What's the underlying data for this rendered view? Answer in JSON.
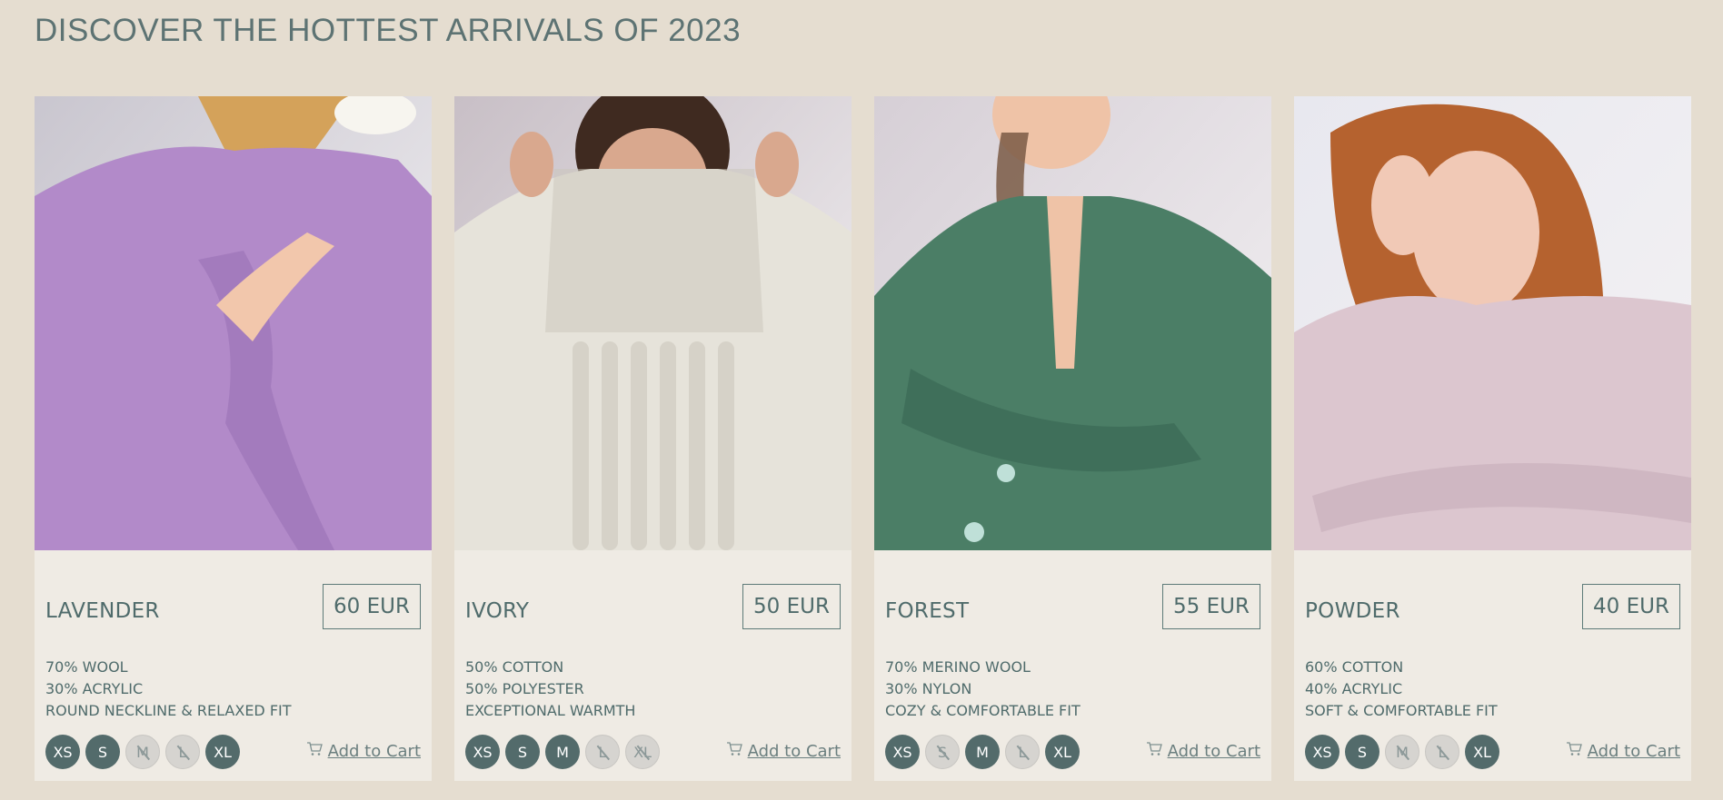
{
  "page": {
    "title": "DISCOVER THE HOTTEST ARRIVALS OF 2023"
  },
  "colors": {
    "background": "#e5ddd0",
    "card": "#efebe4",
    "accent": "#536b6b",
    "disabled": "#d6d4d0"
  },
  "products": [
    {
      "name": "LAVENDER",
      "price": "60 EUR",
      "features": [
        "70% WOOL",
        "30% ACRYLIC",
        "ROUND NECKLINE & RELAXED FIT"
      ],
      "sizes": [
        {
          "label": "XS",
          "available": true
        },
        {
          "label": "S",
          "available": true
        },
        {
          "label": "M",
          "available": false
        },
        {
          "label": "L",
          "available": false
        },
        {
          "label": "XL",
          "available": true
        }
      ],
      "cart_label": "Add to Cart",
      "image_colors": {
        "bg": "#c9c6cf",
        "garment": "#b28ac9",
        "shade": "#9a72b6",
        "skin": "#f2c7ac",
        "hair": "#d4a25a"
      }
    },
    {
      "name": "IVORY",
      "price": "50 EUR",
      "features": [
        "50% COTTON",
        "50% POLYESTER",
        "EXCEPTIONAL WARMTH"
      ],
      "sizes": [
        {
          "label": "XS",
          "available": true
        },
        {
          "label": "S",
          "available": true
        },
        {
          "label": "M",
          "available": true
        },
        {
          "label": "L",
          "available": false
        },
        {
          "label": "XL",
          "available": false
        }
      ],
      "cart_label": "Add to Cart",
      "image_colors": {
        "bg": "#c8bfc6",
        "garment": "#e6e3da",
        "shade": "#c9c5ba",
        "skin": "#d9a88e",
        "hair": "#3f2a20"
      }
    },
    {
      "name": "FOREST",
      "price": "55 EUR",
      "features": [
        "70% MERINO WOOL",
        "30% NYLON",
        "COZY & COMFORTABLE FIT"
      ],
      "sizes": [
        {
          "label": "XS",
          "available": true
        },
        {
          "label": "S",
          "available": false
        },
        {
          "label": "M",
          "available": true
        },
        {
          "label": "L",
          "available": false
        },
        {
          "label": "XL",
          "available": true
        }
      ],
      "cart_label": "Add to Cart",
      "image_colors": {
        "bg": "#d6cfd6",
        "garment": "#4b7e66",
        "shade": "#3b6a55",
        "skin": "#efc3a7",
        "hair": "#7a5a45"
      }
    },
    {
      "name": "POWDER",
      "price": "40 EUR",
      "features": [
        "60% COTTON",
        "40% ACRYLIC",
        "SOFT & COMFORTABLE FIT"
      ],
      "sizes": [
        {
          "label": "XS",
          "available": true
        },
        {
          "label": "S",
          "available": true
        },
        {
          "label": "M",
          "available": false
        },
        {
          "label": "L",
          "available": false
        },
        {
          "label": "XL",
          "available": true
        }
      ],
      "cart_label": "Add to Cart",
      "image_colors": {
        "bg": "#e8e8ef",
        "garment": "#dcc6cf",
        "shade": "#c9b0bc",
        "skin": "#f1c9b6",
        "hair": "#b5622f"
      }
    }
  ]
}
